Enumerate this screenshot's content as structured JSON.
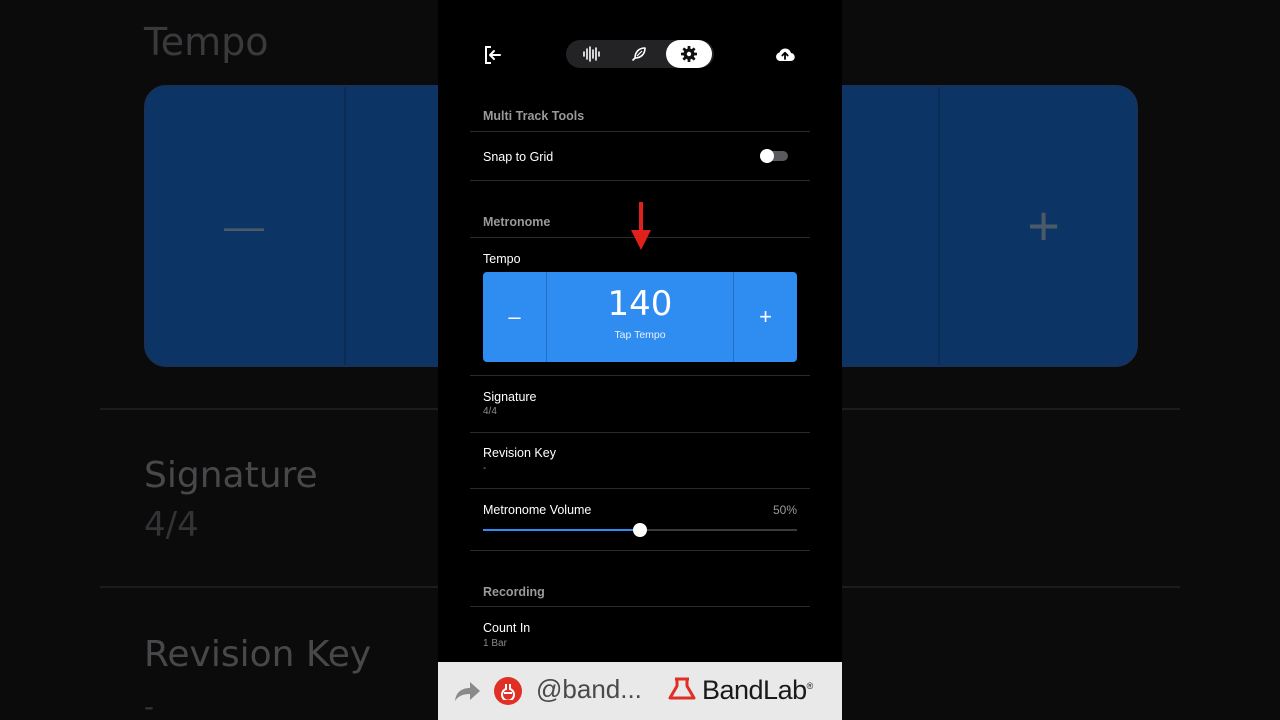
{
  "background": {
    "title": "Tempo",
    "minus_symbol": "—",
    "plus_symbol": "+",
    "signature_label": "Signature",
    "signature_value": "4/4",
    "revision_label": "Revision Key",
    "revision_value": "-"
  },
  "topbar": {
    "exit_icon": "exit-icon",
    "tabs": [
      {
        "icon": "waveform-icon",
        "active": false
      },
      {
        "icon": "feather-icon",
        "active": false
      },
      {
        "icon": "gear-icon",
        "active": true
      }
    ],
    "upload_icon": "cloud-upload-icon"
  },
  "multitrack": {
    "section_title": "Multi Track Tools",
    "snap_label": "Snap to Grid",
    "snap_enabled": false
  },
  "metronome": {
    "section_title": "Metronome",
    "tempo_label": "Tempo",
    "tempo_value": "140",
    "tap_tempo_label": "Tap Tempo",
    "minus_symbol": "–",
    "plus_symbol": "+",
    "signature_label": "Signature",
    "signature_value": "4/4",
    "revision_label": "Revision Key",
    "revision_value": "-",
    "volume_label": "Metronome Volume",
    "volume_display": "50%",
    "volume_fraction": 0.5
  },
  "recording": {
    "section_title": "Recording",
    "count_in_label": "Count In",
    "count_in_value": "1 Bar"
  },
  "watermark": {
    "handle": "@band...",
    "brand": "BandLab",
    "registered": "®"
  },
  "colors": {
    "accent": "#2f8cf0",
    "annotation_arrow": "#e0201a",
    "bandlab_red": "#e02f25"
  }
}
